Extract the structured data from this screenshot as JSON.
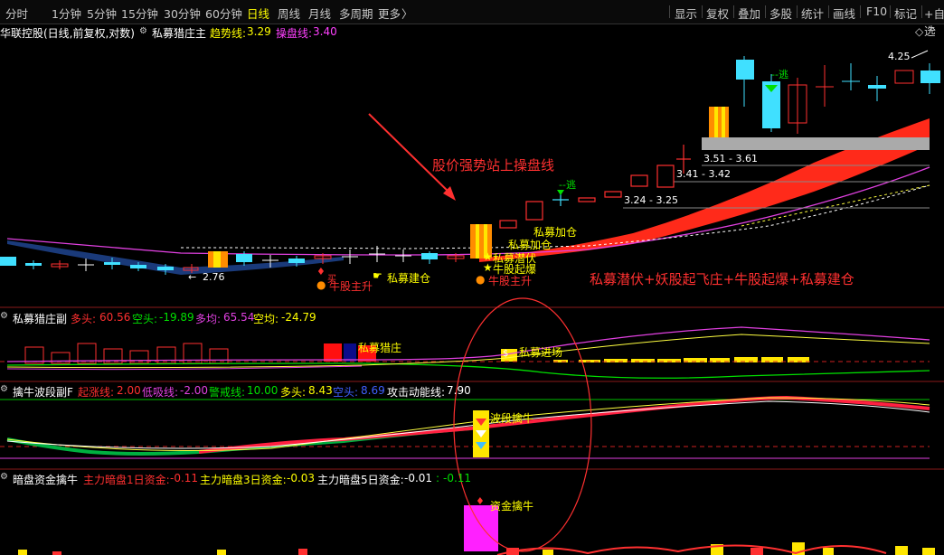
{
  "toolbar": {
    "timeframes": [
      "分时",
      "1分钟",
      "5分钟",
      "15分钟",
      "30分钟",
      "60分钟",
      "日线",
      "周线",
      "月线",
      "多周期",
      "更多"
    ],
    "more_arrow": "〉",
    "tools": [
      "显示",
      "复权",
      "叠加",
      "多股",
      "统计",
      "画线",
      "F10",
      "标记",
      "+自选"
    ]
  },
  "main_panel": {
    "stock": "华联控股(日线,前复权,对数)",
    "indicator": "私募猎庄主",
    "trend_label": "趋势线:",
    "trend_value": "3.29",
    "operate_label": "操盘线:",
    "operate_value": "3.40",
    "annotation_main": "股价强势站上操盘线",
    "annotation_bottom": "私募潜伏+妖股起飞庄+牛股起爆+私募建仓",
    "price_low": "2.76",
    "price_high": "4.25",
    "levels": [
      "3.51 - 3.61",
      "3.41 - 3.42",
      "3.24 - 3.25"
    ],
    "escape1": "--逃",
    "escape2": "--逃",
    "sig_add1": "私募加仓",
    "sig_add2": "私募加仓",
    "sig_hide": "私募潜伏",
    "sig_boom": "牛股起爆",
    "sig_rise1": "牛股主升",
    "sig_rise2": "牛股主升",
    "sig_build": "私募建仓",
    "sig_buy": "买"
  },
  "panel2": {
    "name": "私募猎庄副",
    "items": [
      {
        "label": "多头:",
        "value": "60.56",
        "color": "#ff3030"
      },
      {
        "label": "空头:",
        "value": "-19.89",
        "color": "#00e000"
      },
      {
        "label": "多均:",
        "value": "65.54",
        "color": "#e040e0"
      },
      {
        "label": "空均:",
        "value": "-24.79",
        "color": "#ffff00"
      }
    ],
    "sig1": "私募猎庄",
    "sig2": "私募进场"
  },
  "panel3": {
    "name": "擒牛波段副F",
    "items": [
      {
        "label": "起涨线:",
        "value": "2.00",
        "color": "#ff3030"
      },
      {
        "label": "低吸线:",
        "value": "-2.00",
        "color": "#e040e0"
      },
      {
        "label": "警戒线:",
        "value": "10.00",
        "color": "#00e000"
      },
      {
        "label": "多头:",
        "value": "8.43",
        "color": "#ffff00"
      },
      {
        "label": "空头:",
        "value": "8.69",
        "color": "#4060ff"
      },
      {
        "label": "攻击动能线:",
        "value": "7.90",
        "color": "#ffffff"
      }
    ],
    "sig": "波段擒牛"
  },
  "panel4": {
    "name": "暗盘资金擒牛",
    "items": [
      {
        "label": "主力暗盘1日资金:",
        "value": "-0.11",
        "color": "#ff3030"
      },
      {
        "label": "主力暗盘3日资金:",
        "value": "-0.03",
        "color": "#ffff00"
      },
      {
        "label": "主力暗盘5日资金:",
        "value": "-0.01",
        "color": "#ffffff"
      },
      {
        "label": ":",
        "value": "-0.11",
        "color": "#00e000"
      }
    ],
    "sig": "资金擒牛"
  }
}
